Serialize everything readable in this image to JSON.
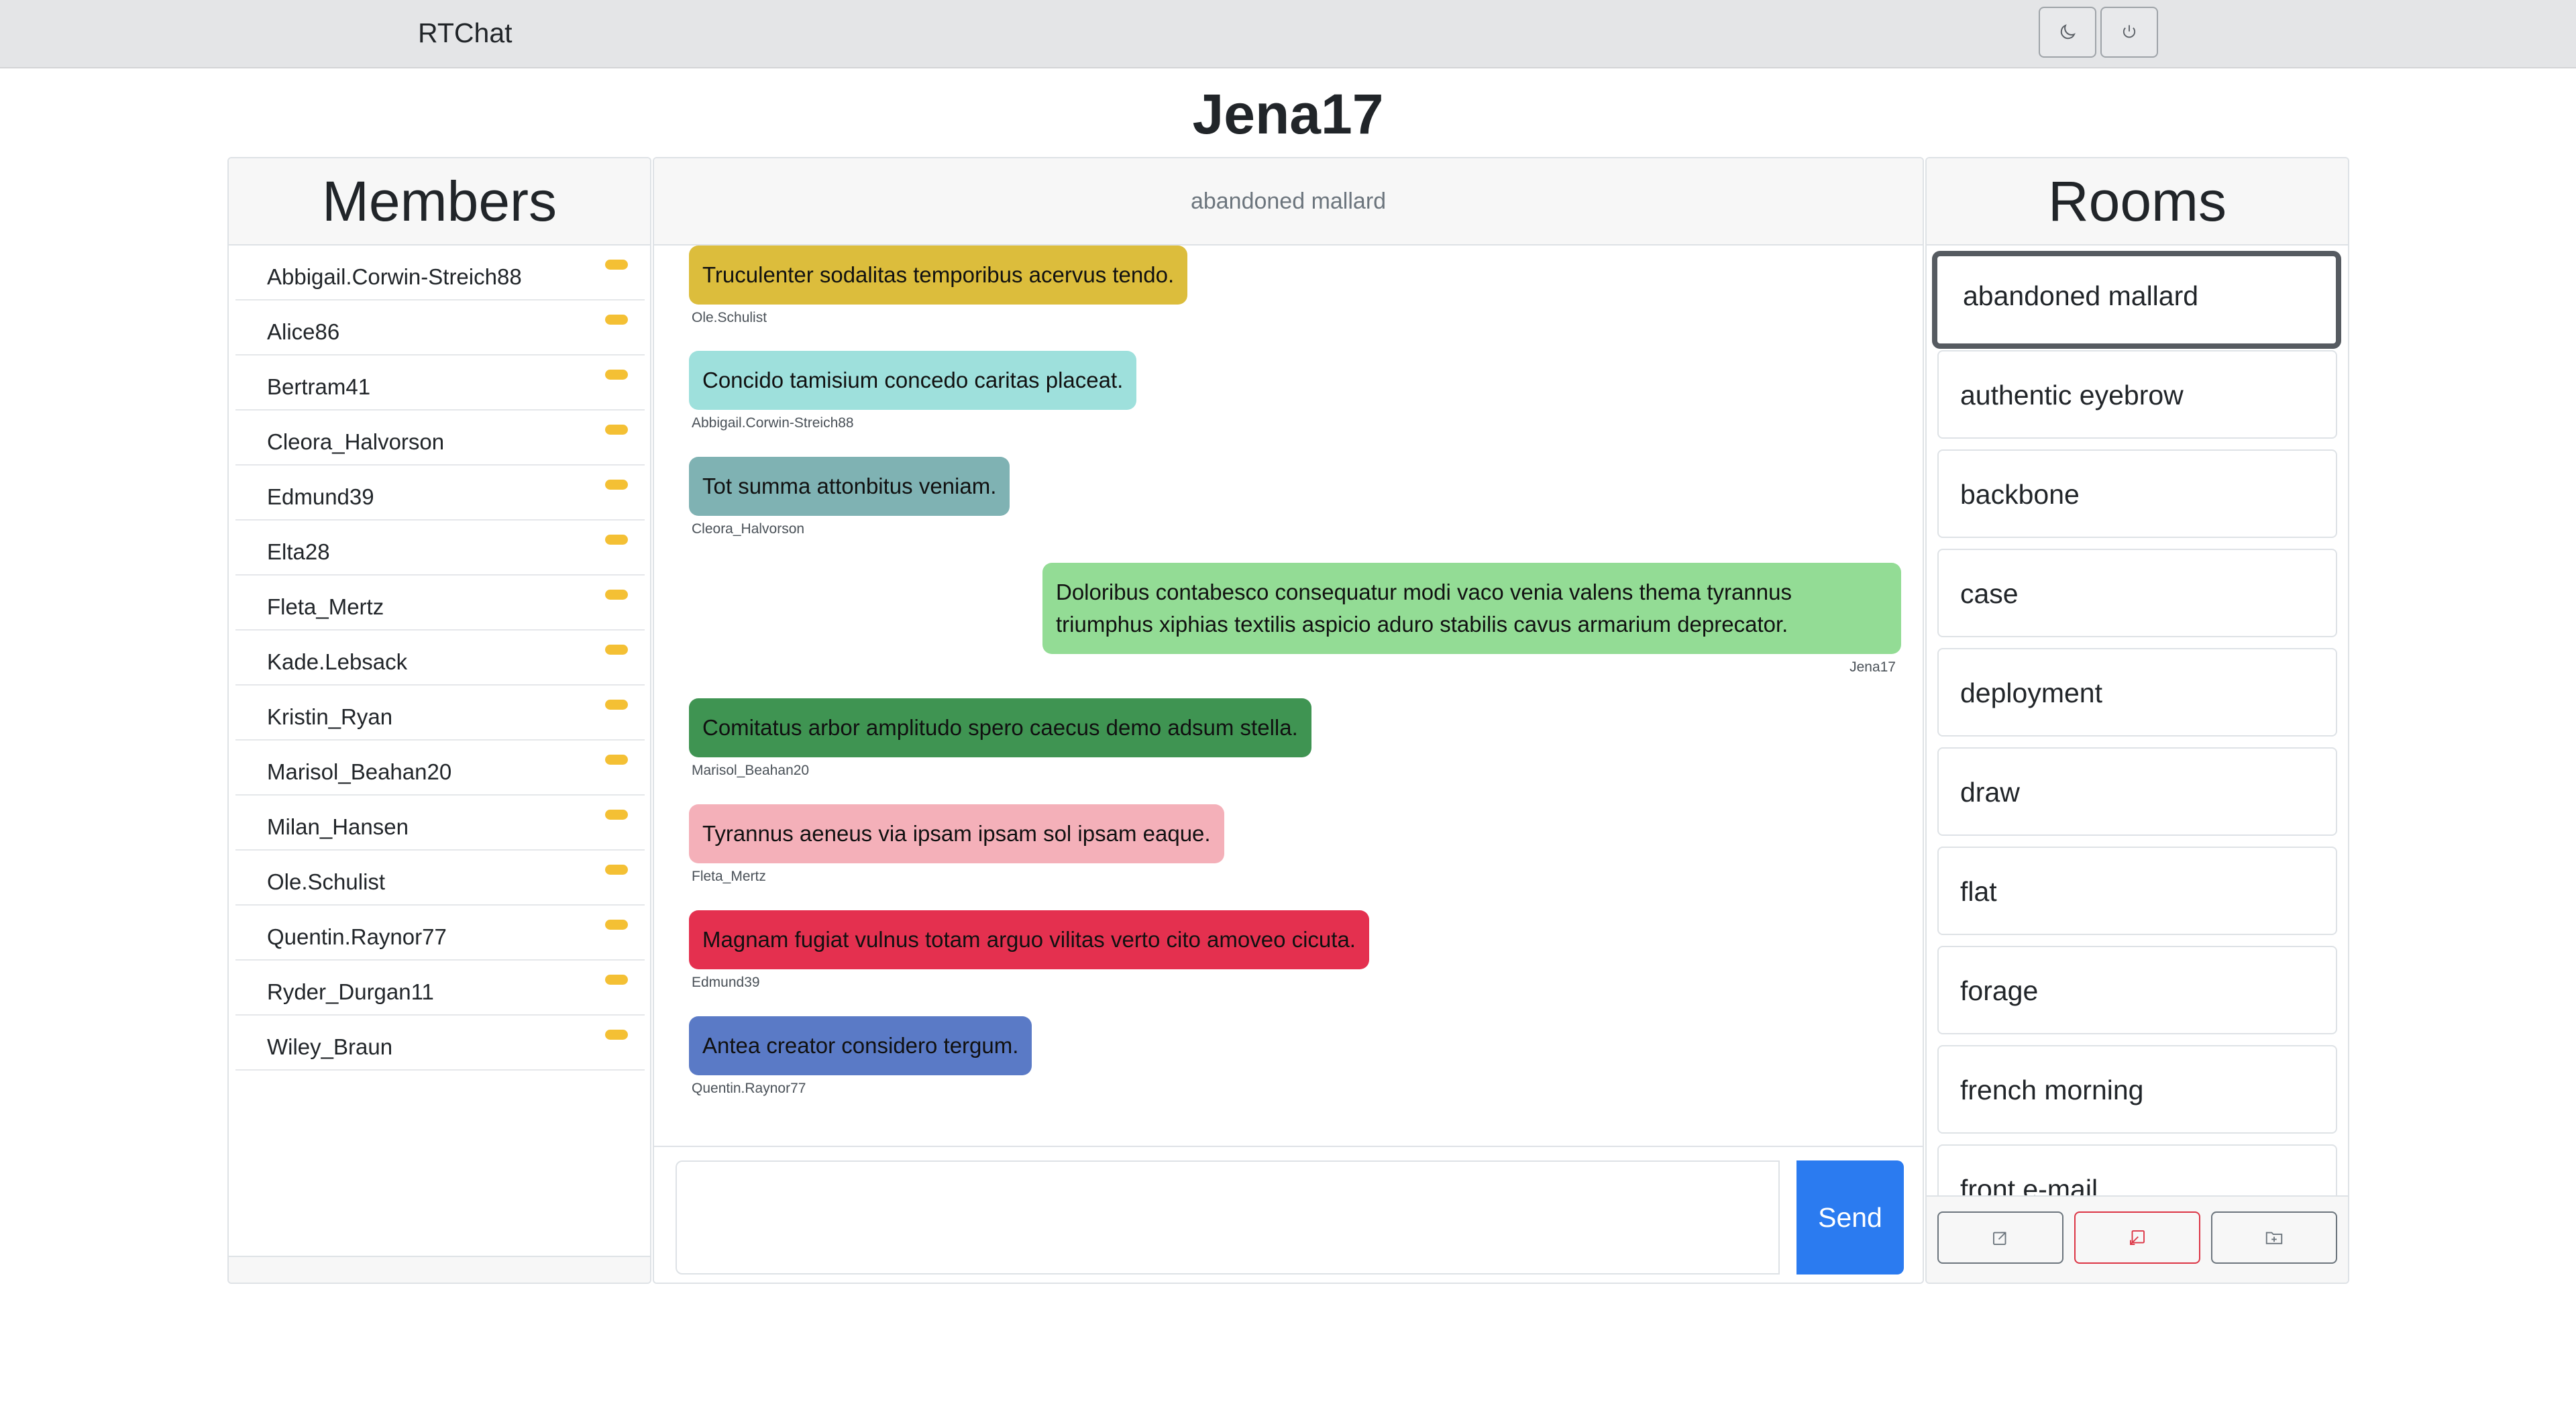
{
  "app": {
    "brand": "RTChat"
  },
  "header_icons": {
    "theme": "moon-icon",
    "logout": "power-icon"
  },
  "user": {
    "name": "Jena17"
  },
  "members": {
    "title": "Members",
    "items": [
      "Abbigail.Corwin-Streich88",
      "Alice86",
      "Bertram41",
      "Cleora_Halvorson",
      "Edmund39",
      "Elta28",
      "Fleta_Mertz",
      "Kade.Lebsack",
      "Kristin_Ryan",
      "Marisol_Beahan20",
      "Milan_Hansen",
      "Ole.Schulist",
      "Quentin.Raynor77",
      "Ryder_Durgan11",
      "Wiley_Braun"
    ],
    "status_color": "#f4c034"
  },
  "chat": {
    "room_name": "abandoned mallard",
    "messages": [
      {
        "text": "Truculenter sodalitas temporibus acervus tendo.",
        "author": "Ole.Schulist",
        "color": "#dcbd3c",
        "side": "left"
      },
      {
        "text": "Concido tamisium concedo caritas placeat.",
        "author": "Abbigail.Corwin-Streich88",
        "color": "#9ee0dc",
        "side": "left"
      },
      {
        "text": "Tot summa attonbitus veniam.",
        "author": "Cleora_Halvorson",
        "color": "#7fb2b3",
        "side": "left"
      },
      {
        "text": "Doloribus contabesco consequatur modi vaco venia valens thema tyrannus triumphus xiphias textilis aspicio aduro stabilis cavus armarium deprecator.",
        "author": "Jena17",
        "color": "#93dc95",
        "side": "right"
      },
      {
        "text": "Comitatus arbor amplitudo spero caecus demo adsum stella.",
        "author": "Marisol_Beahan20",
        "color": "#3f9452",
        "side": "left"
      },
      {
        "text": "Tyrannus aeneus via ipsam ipsam sol ipsam eaque.",
        "author": "Fleta_Mertz",
        "color": "#f4b0b9",
        "side": "left"
      },
      {
        "text": "Magnam fugiat vulnus totam arguo vilitas verto cito amoveo cicuta.",
        "author": "Edmund39",
        "color": "#e4304f",
        "side": "left"
      },
      {
        "text": "Antea creator considero tergum.",
        "author": "Quentin.Raynor77",
        "color": "#5a7ac6",
        "side": "left"
      }
    ],
    "composer": {
      "value": "",
      "send_label": "Send"
    }
  },
  "rooms": {
    "title": "Rooms",
    "items": [
      "abandoned mallard",
      "authentic eyebrow",
      "backbone",
      "case",
      "deployment",
      "draw",
      "flat",
      "forage",
      "french morning",
      "front e-mail"
    ],
    "active_index": 0,
    "actions": {
      "join": "external-link-icon",
      "leave": "leave-room-icon",
      "create": "folder-plus-icon"
    }
  }
}
